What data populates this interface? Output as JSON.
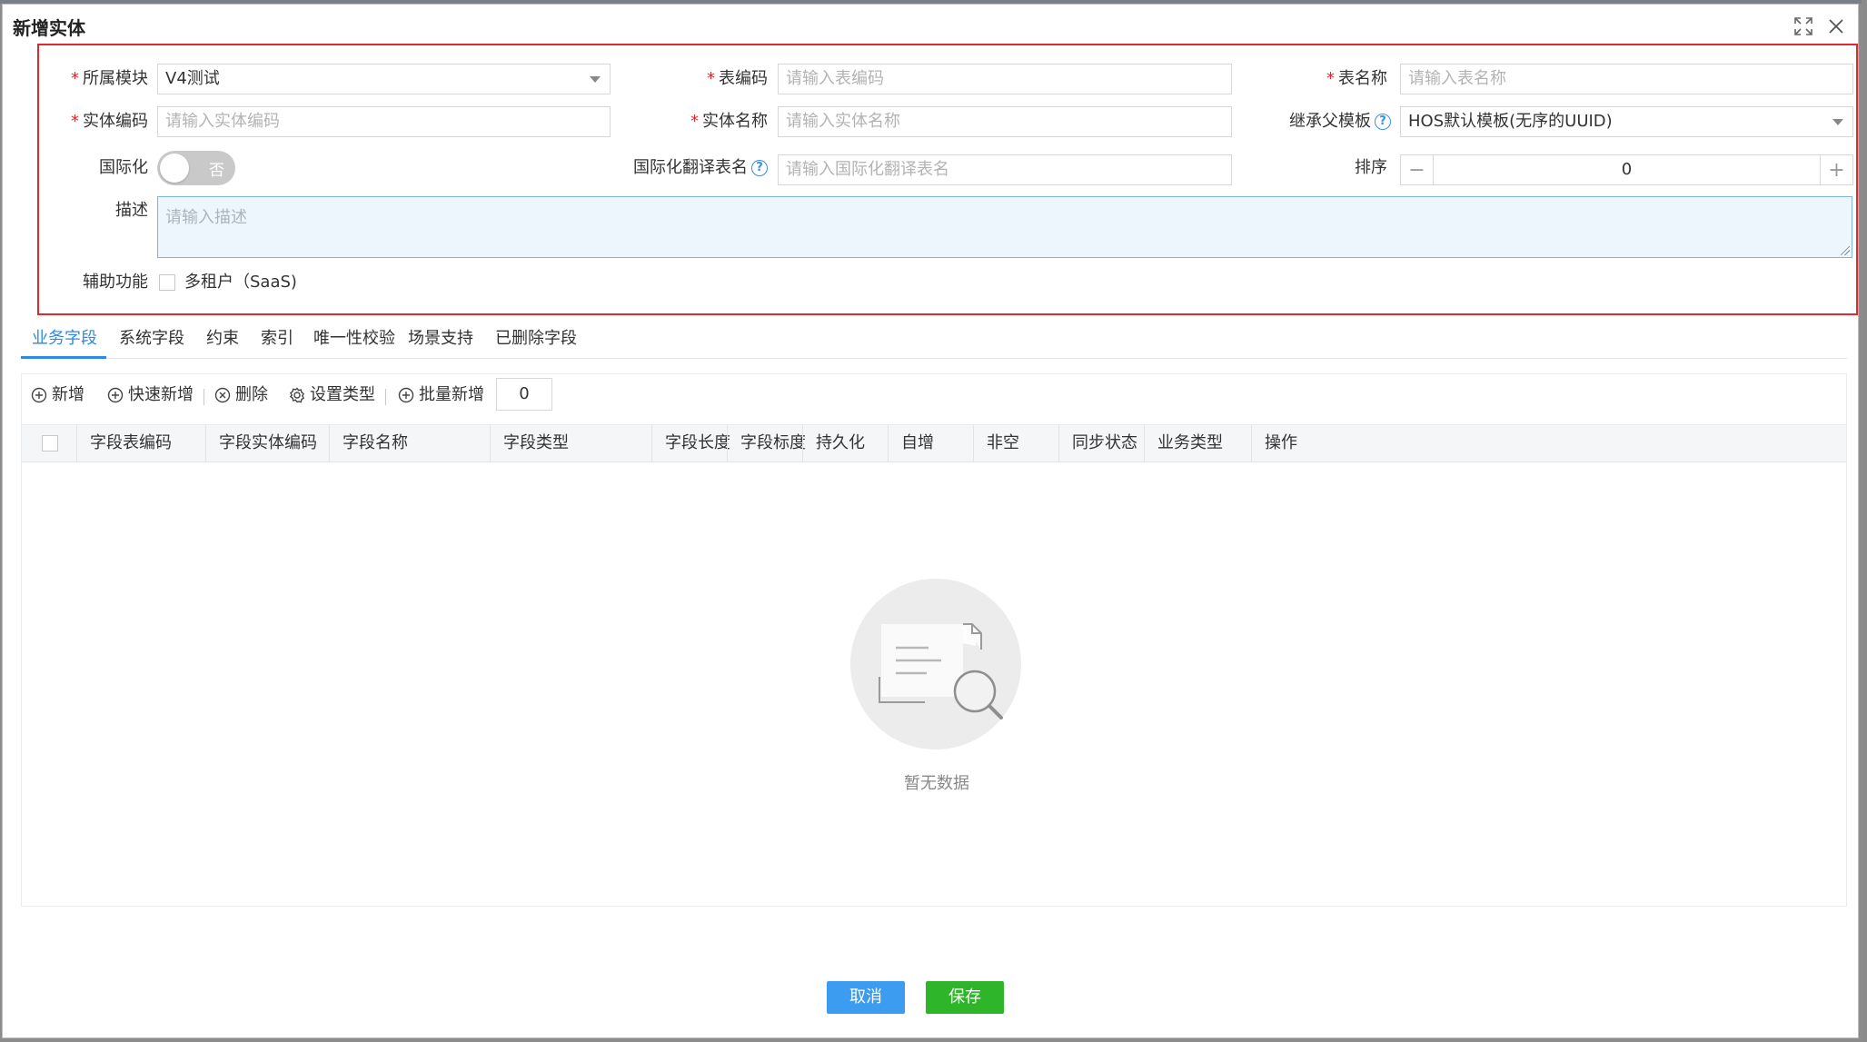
{
  "modal": {
    "title": "新增实体"
  },
  "form": {
    "module": {
      "label": "所属模块",
      "value": "V4测试"
    },
    "table_code": {
      "label": "表编码",
      "placeholder": "请输入表编码"
    },
    "table_name": {
      "label": "表名称",
      "placeholder": "请输入表名称"
    },
    "entity_code": {
      "label": "实体编码",
      "placeholder": "请输入实体编码"
    },
    "entity_name": {
      "label": "实体名称",
      "placeholder": "请输入实体名称"
    },
    "parent_template": {
      "label": "继承父模板",
      "value": "HOS默认模板(无序的UUID)"
    },
    "i18n": {
      "label": "国际化",
      "switch_text": "否"
    },
    "i18n_table": {
      "label": "国际化翻译表名",
      "placeholder": "请输入国际化翻译表名"
    },
    "sort": {
      "label": "排序",
      "value": "0",
      "minus": "−",
      "plus": "+"
    },
    "description": {
      "label": "描述",
      "placeholder": "请输入描述"
    },
    "aux": {
      "label": "辅助功能",
      "option": "多租户（SaaS)"
    },
    "required_mark": "*",
    "help_mark": "?"
  },
  "tabs": [
    "业务字段",
    "系统字段",
    "约束",
    "索引",
    "唯一性校验",
    "场景支持",
    "已删除字段"
  ],
  "toolbar": {
    "add": "新增",
    "quick_add": "快速新增",
    "delete": "删除",
    "set_type": "设置类型",
    "batch_add": "批量新增",
    "batch_count": "0"
  },
  "table": {
    "columns": [
      "字段表编码",
      "字段实体编码",
      "字段名称",
      "字段类型",
      "字段长度",
      "字段标度",
      "持久化",
      "自增",
      "非空",
      "同步状态",
      "业务类型",
      "操作"
    ],
    "empty_text": "暂无数据"
  },
  "footer": {
    "cancel": "取消",
    "save": "保存"
  },
  "colors": {
    "accent": "#2d8ae6",
    "required": "#e0282e",
    "save": "#2fb52a",
    "cancel": "#3b9cf0"
  }
}
